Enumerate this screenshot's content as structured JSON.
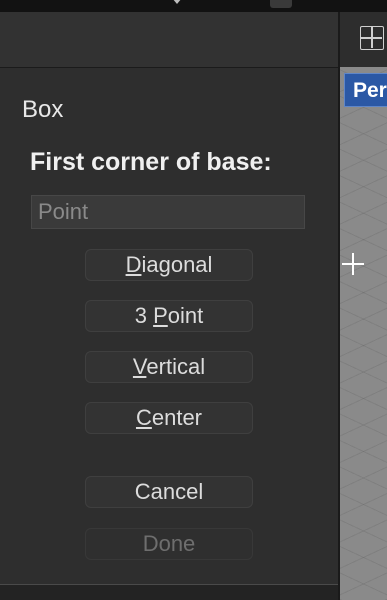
{
  "dialog": {
    "title": "Box",
    "prompt": "First corner of base:",
    "point_placeholder": "Point",
    "options": [
      {
        "prefix": "",
        "mnemonic": "D",
        "rest": "iagonal"
      },
      {
        "prefix": "3 ",
        "mnemonic": "P",
        "rest": "oint"
      },
      {
        "prefix": "",
        "mnemonic": "V",
        "rest": "ertical"
      },
      {
        "prefix": "",
        "mnemonic": "C",
        "rest": "enter"
      }
    ],
    "cancel_label": "Cancel",
    "done_label": "Done"
  },
  "viewport": {
    "tab_label": "Per",
    "tab_color": "#2b58a5"
  },
  "toolbar": {
    "layout_icon": "viewport-layout-icon"
  }
}
